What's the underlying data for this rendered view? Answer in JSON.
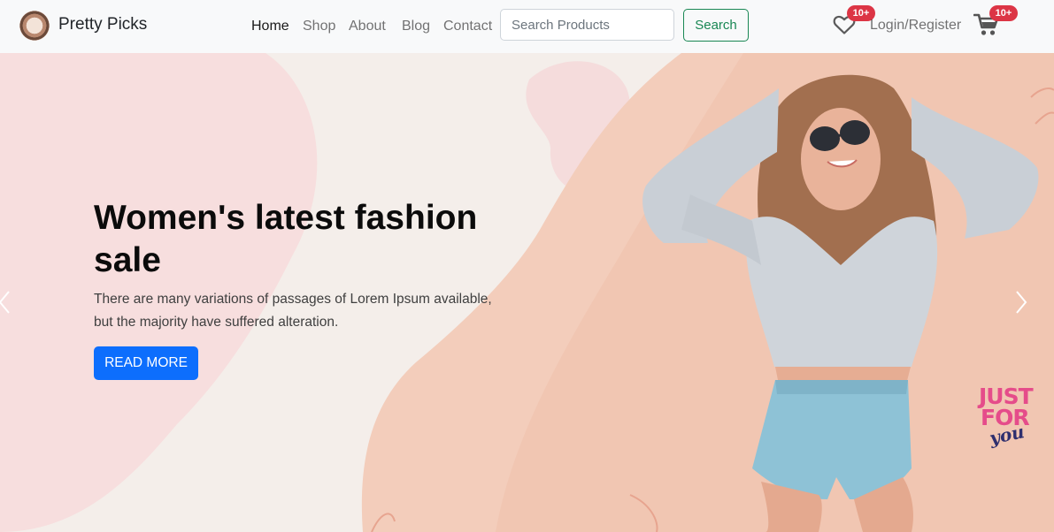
{
  "brand": {
    "name": "Pretty Picks",
    "logo_icon": "flower-wreath-logo"
  },
  "nav": {
    "links": [
      {
        "label": "Home",
        "active": true
      },
      {
        "label": "Shop",
        "active": false
      },
      {
        "label": "About",
        "active": false
      },
      {
        "label": "Blog",
        "active": false
      },
      {
        "label": "Contact",
        "active": false
      }
    ]
  },
  "search": {
    "placeholder": "Search Products",
    "value": "",
    "button_label": "Search"
  },
  "account": {
    "wishlist_icon": "heart-icon",
    "wishlist_badge": "10+",
    "login_label": "Login/Register",
    "cart_icon": "cart-icon",
    "cart_badge": "10+"
  },
  "hero": {
    "title": "Women's latest fashion sale",
    "description": "There are many variations of passages of Lorem Ipsum available, but the majority have suffered alteration.",
    "button_label": "READ MORE",
    "stamp": {
      "line1": "JUST",
      "line2": "FOR",
      "line3": "you"
    },
    "prev_icon": "chevron-left-icon",
    "next_icon": "chevron-right-icon"
  },
  "colors": {
    "navbar_bg": "#f8f9fa",
    "search_button": "#198754",
    "badge": "#dc3545",
    "primary_button": "#0d6efd",
    "hero_pink": "#f7dcdc",
    "hero_peach": "#f2c9b6",
    "stamp_pink": "#e54c8a"
  }
}
